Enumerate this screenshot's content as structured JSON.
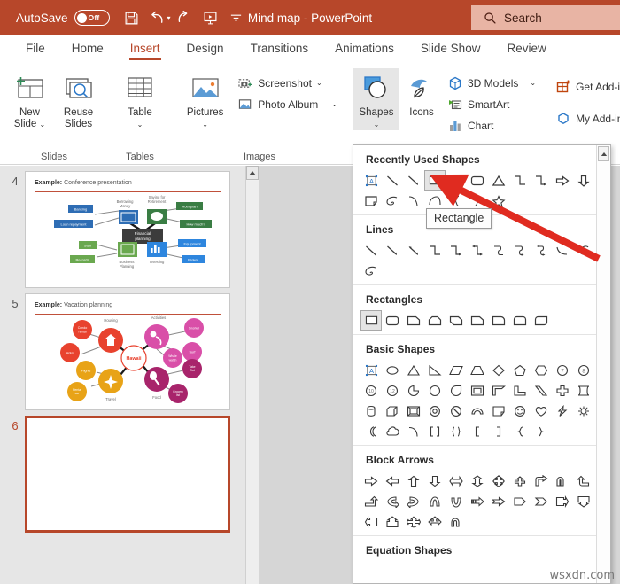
{
  "titlebar": {
    "autosave_label": "AutoSave",
    "autosave_state": "Off",
    "doc_title": "Mind map  -  PowerPoint",
    "search_placeholder": "Search",
    "qat": [
      {
        "name": "save-icon",
        "tip": "Save"
      },
      {
        "name": "undo-icon",
        "tip": "Undo"
      },
      {
        "name": "redo-icon",
        "tip": "Redo"
      },
      {
        "name": "present-icon",
        "tip": "Start From Beginning"
      },
      {
        "name": "customize-qat-icon",
        "tip": "Customize Quick Access Toolbar"
      }
    ],
    "accent_color": "#b7472a"
  },
  "tabs": [
    {
      "label": "File",
      "active": false
    },
    {
      "label": "Home",
      "active": false
    },
    {
      "label": "Insert",
      "active": true
    },
    {
      "label": "Design",
      "active": false
    },
    {
      "label": "Transitions",
      "active": false
    },
    {
      "label": "Animations",
      "active": false
    },
    {
      "label": "Slide Show",
      "active": false
    },
    {
      "label": "Review",
      "active": false
    }
  ],
  "ribbon": {
    "groups": [
      {
        "name": "slides",
        "label": "Slides",
        "buttons": [
          {
            "label": "New\nSlide",
            "label_l1": "New",
            "label_l2": "Slide",
            "dropdown": true
          },
          {
            "label": "Reuse\nSlides",
            "label_l1": "Reuse",
            "label_l2": "Slides",
            "dropdown": false
          }
        ]
      },
      {
        "name": "tables",
        "label": "Tables",
        "buttons": [
          {
            "label_l1": "Table",
            "label_l2": "",
            "dropdown": true
          }
        ]
      },
      {
        "name": "images",
        "label": "Images",
        "buttons": [
          {
            "label_l1": "Pictures",
            "label_l2": "",
            "dropdown": true
          }
        ],
        "small_buttons": [
          {
            "label": "Screenshot",
            "icon": "screenshot-icon",
            "dropdown": true
          },
          {
            "label": "Photo Album",
            "icon": "photo-album-icon",
            "dropdown": true
          }
        ]
      },
      {
        "name": "illustrations",
        "label": "",
        "buttons": [
          {
            "label_l1": "Shapes",
            "label_l2": "",
            "dropdown": true,
            "selected": true
          },
          {
            "label_l1": "Icons",
            "label_l2": "",
            "dropdown": false
          }
        ],
        "small_buttons": [
          {
            "label": "3D Models",
            "icon": "3d-models-icon",
            "dropdown": true
          },
          {
            "label": "SmartArt",
            "icon": "smartart-icon",
            "dropdown": false
          },
          {
            "label": "Chart",
            "icon": "chart-icon",
            "dropdown": false
          }
        ]
      },
      {
        "name": "addins",
        "label": "",
        "small_buttons": [
          {
            "label": "Get Add-ins",
            "icon": "get-addins-icon",
            "dropdown": false
          },
          {
            "label": "My Add-ins",
            "icon": "my-addins-icon",
            "dropdown": false
          }
        ]
      }
    ]
  },
  "slides": [
    {
      "number": "4",
      "title_prefix": "Example:",
      "title_rest": " Conference presentation",
      "selected": false,
      "kind": "mindmap-financial",
      "center_label": "Financial planning",
      "nodes": [
        {
          "label": "Banking",
          "color": "#2e6db4"
        },
        {
          "label": "Loan repayment",
          "color": "#2e6db4"
        },
        {
          "label": "Borrowing Money",
          "color": "#2e6db4"
        },
        {
          "label": "Saving for Retirement",
          "color": "#3a7d44"
        },
        {
          "label": "Roth plan",
          "color": "#3a7d44"
        },
        {
          "label": "How much?",
          "color": "#3a7d44"
        },
        {
          "label": "Staff",
          "color": "#6aa84f"
        },
        {
          "label": "Records",
          "color": "#6aa84f"
        },
        {
          "label": "Business Planning",
          "color": "#6aa84f"
        },
        {
          "label": "Equipment",
          "color": "#2e86de"
        },
        {
          "label": "Broker",
          "color": "#2e86de"
        },
        {
          "label": "Investing",
          "color": "#2e86de"
        }
      ]
    },
    {
      "number": "5",
      "title_prefix": "Example:",
      "title_rest": " Vacation planning",
      "selected": false,
      "kind": "mindmap-vacation",
      "center_label": "Hawaii",
      "nodes": [
        {
          "label": "Condo rental",
          "color": "#e8422e"
        },
        {
          "label": "Hotel",
          "color": "#e8422e"
        },
        {
          "label": "Housing",
          "color": "#e8422e"
        },
        {
          "label": "Activities",
          "color": "#d94fa8"
        },
        {
          "label": "Snorkel",
          "color": "#d94fa8"
        },
        {
          "label": "Surf",
          "color": "#d94fa8"
        },
        {
          "label": "Whale watch",
          "color": "#d94fa8"
        },
        {
          "label": "Flights",
          "color": "#e8a317"
        },
        {
          "label": "Rental car",
          "color": "#e8a317"
        },
        {
          "label": "Travel",
          "color": "#e8a317"
        },
        {
          "label": "Food",
          "color": "#a8246b"
        },
        {
          "label": "Take Out",
          "color": "#a8246b"
        },
        {
          "label": "Grocery list",
          "color": "#a8246b"
        }
      ]
    },
    {
      "number": "6",
      "title_prefix": "",
      "title_rest": "",
      "selected": true,
      "kind": "blank",
      "center_label": "",
      "nodes": []
    }
  ],
  "shapes_panel": {
    "tooltip": "Rectangle",
    "sections": [
      {
        "title": "Recently Used Shapes",
        "shapes": [
          {
            "name": "text-box-shape",
            "glyph": "A",
            "selected": false,
            "boxed": true
          },
          {
            "name": "line-shape",
            "glyph": "line"
          },
          {
            "name": "line-arrow-shape",
            "glyph": "line-arrow"
          },
          {
            "name": "rectangle-shape",
            "glyph": "rect",
            "selected": true
          },
          {
            "name": "oval-shape",
            "glyph": "oval"
          },
          {
            "name": "rounded-rectangle-shape",
            "glyph": "rrect"
          },
          {
            "name": "isosceles-triangle-shape",
            "glyph": "tri"
          },
          {
            "name": "elbow-connector-shape",
            "glyph": "elbow"
          },
          {
            "name": "elbow-arrow-connector-shape",
            "glyph": "elbow-arrow"
          },
          {
            "name": "right-arrow-shape",
            "glyph": "right-arrow"
          },
          {
            "name": "down-arrow-shape",
            "glyph": "down-arrow"
          },
          {
            "name": "folded-corner-shape",
            "glyph": "folded"
          },
          {
            "name": "scribble-shape",
            "glyph": "scribble"
          },
          {
            "name": "curve-shape",
            "glyph": "curve"
          },
          {
            "name": "arc-shape",
            "glyph": "arc"
          },
          {
            "name": "left-brace-shape",
            "glyph": "lbrace"
          },
          {
            "name": "right-brace-shape",
            "glyph": "rbrace"
          },
          {
            "name": "star-5-point-shape",
            "glyph": "star"
          }
        ]
      },
      {
        "title": "Lines",
        "shapes": [
          {
            "name": "line-shape",
            "glyph": "line"
          },
          {
            "name": "line-arrow-shape",
            "glyph": "line-arrow"
          },
          {
            "name": "line-double-arrow-shape",
            "glyph": "line-arrow2"
          },
          {
            "name": "elbow-connector-shape",
            "glyph": "elbow"
          },
          {
            "name": "elbow-arrow-connector-shape",
            "glyph": "elbow-arrow"
          },
          {
            "name": "elbow-double-arrow-connector-shape",
            "glyph": "elbow-arrow2"
          },
          {
            "name": "curved-connector-shape",
            "glyph": "curve-conn"
          },
          {
            "name": "curved-arrow-connector-shape",
            "glyph": "curve-arrow"
          },
          {
            "name": "curved-double-arrow-connector-shape",
            "glyph": "curve-arrow2"
          },
          {
            "name": "curve-shape",
            "glyph": "arc"
          },
          {
            "name": "freeform-shape-shape",
            "glyph": "freeform"
          },
          {
            "name": "scribble-shape",
            "glyph": "scribble"
          }
        ]
      },
      {
        "title": "Rectangles",
        "shapes": [
          {
            "name": "rectangle-shape",
            "glyph": "rect",
            "selected": true
          },
          {
            "name": "rounded-rectangle-shape",
            "glyph": "rrect"
          },
          {
            "name": "snip-single-corner-rectangle-shape",
            "glyph": "snip1"
          },
          {
            "name": "snip-same-side-corner-rectangle-shape",
            "glyph": "snip2"
          },
          {
            "name": "snip-diagonal-corner-rectangle-shape",
            "glyph": "snip3"
          },
          {
            "name": "snip-and-round-single-corner-rectangle-shape",
            "glyph": "snip4"
          },
          {
            "name": "round-single-corner-rectangle-shape",
            "glyph": "round1"
          },
          {
            "name": "round-same-side-corner-rectangle-shape",
            "glyph": "round2"
          },
          {
            "name": "round-diagonal-corner-rectangle-shape",
            "glyph": "round3"
          }
        ]
      },
      {
        "title": "Basic Shapes",
        "shapes": [
          {
            "name": "text-box-shape",
            "glyph": "A",
            "boxed": true
          },
          {
            "name": "oval-shape",
            "glyph": "oval"
          },
          {
            "name": "isosceles-triangle-shape",
            "glyph": "tri"
          },
          {
            "name": "right-triangle-shape",
            "glyph": "rtri"
          },
          {
            "name": "parallelogram-shape",
            "glyph": "para"
          },
          {
            "name": "trapezoid-shape",
            "glyph": "trap"
          },
          {
            "name": "diamond-shape",
            "glyph": "diamond"
          },
          {
            "name": "pentagon-shape",
            "glyph": "pent"
          },
          {
            "name": "hexagon-shape",
            "glyph": "hex"
          },
          {
            "name": "heptagon-shape",
            "glyph": "hept7"
          },
          {
            "name": "octagon-shape",
            "glyph": "oct8"
          },
          {
            "name": "decagon-shape",
            "glyph": "dec10"
          },
          {
            "name": "dodecagon-shape",
            "glyph": "dod12"
          },
          {
            "name": "pie-shape",
            "glyph": "pie"
          },
          {
            "name": "chord-shape",
            "glyph": "chord"
          },
          {
            "name": "teardrop-shape",
            "glyph": "teardrop"
          },
          {
            "name": "frame-shape",
            "glyph": "frame"
          },
          {
            "name": "half-frame-shape",
            "glyph": "halfframe"
          },
          {
            "name": "l-shape-shape",
            "glyph": "lshape"
          },
          {
            "name": "diagonal-stripe-shape",
            "glyph": "stripe"
          },
          {
            "name": "cross-shape",
            "glyph": "cross"
          },
          {
            "name": "plaque-shape",
            "glyph": "plaque"
          },
          {
            "name": "can-shape",
            "glyph": "can"
          },
          {
            "name": "cube-shape",
            "glyph": "cube"
          },
          {
            "name": "bevel-shape",
            "glyph": "bevel"
          },
          {
            "name": "donut-shape",
            "glyph": "donut"
          },
          {
            "name": "no-symbol-shape",
            "glyph": "nosym"
          },
          {
            "name": "block-arc-shape",
            "glyph": "blockarc"
          },
          {
            "name": "folded-corner-shape",
            "glyph": "folded"
          },
          {
            "name": "smiley-face-shape",
            "glyph": "smiley"
          },
          {
            "name": "heart-shape",
            "glyph": "heart"
          },
          {
            "name": "lightning-bolt-shape",
            "glyph": "bolt"
          },
          {
            "name": "sun-shape",
            "glyph": "sun"
          },
          {
            "name": "moon-shape",
            "glyph": "moon"
          },
          {
            "name": "cloud-shape",
            "glyph": "cloud"
          },
          {
            "name": "arc-shape",
            "glyph": "arc2"
          },
          {
            "name": "double-bracket-shape",
            "glyph": "dbracket"
          },
          {
            "name": "double-brace-shape",
            "glyph": "dbrace"
          },
          {
            "name": "left-bracket-shape",
            "glyph": "lbracket"
          },
          {
            "name": "right-bracket-shape",
            "glyph": "rbracket"
          },
          {
            "name": "left-brace-shape",
            "glyph": "lbrace"
          },
          {
            "name": "right-brace-shape",
            "glyph": "rbrace"
          }
        ]
      },
      {
        "title": "Block Arrows",
        "shapes": [
          {
            "name": "right-arrow-shape",
            "glyph": "ba-right"
          },
          {
            "name": "left-arrow-shape",
            "glyph": "ba-left"
          },
          {
            "name": "up-arrow-shape",
            "glyph": "ba-up"
          },
          {
            "name": "down-arrow-shape",
            "glyph": "ba-down"
          },
          {
            "name": "left-right-arrow-shape",
            "glyph": "ba-lr"
          },
          {
            "name": "up-down-arrow-shape",
            "glyph": "ba-ud"
          },
          {
            "name": "four-way-arrow-shape",
            "glyph": "ba-quad"
          },
          {
            "name": "tee-arrow-shape",
            "glyph": "ba-tee"
          },
          {
            "name": "bent-arrow-shape",
            "glyph": "ba-bent"
          },
          {
            "name": "u-turn-arrow-shape",
            "glyph": "ba-uturn"
          },
          {
            "name": "left-up-arrow-shape",
            "glyph": "ba-leftup"
          },
          {
            "name": "bent-up-arrow-shape",
            "glyph": "ba-bentup"
          },
          {
            "name": "curved-right-arrow-shape",
            "glyph": "ba-curvedright"
          },
          {
            "name": "curved-left-arrow-shape",
            "glyph": "ba-curvedleft"
          },
          {
            "name": "curved-up-arrow-shape",
            "glyph": "ba-curvedup"
          },
          {
            "name": "curved-down-arrow-shape",
            "glyph": "ba-curveddown"
          },
          {
            "name": "striped-right-arrow-shape",
            "glyph": "ba-striped"
          },
          {
            "name": "notched-right-arrow-shape",
            "glyph": "ba-notched"
          },
          {
            "name": "pentagon-arrow-shape",
            "glyph": "ba-pentagon"
          },
          {
            "name": "chevron-shape",
            "glyph": "ba-chevron"
          },
          {
            "name": "right-arrow-callout-shape",
            "glyph": "ba-callout-r"
          },
          {
            "name": "down-arrow-callout-shape",
            "glyph": "ba-callout-d"
          },
          {
            "name": "left-arrow-callout-shape",
            "glyph": "ba-callout-l"
          },
          {
            "name": "up-arrow-callout-shape",
            "glyph": "ba-callout-u"
          },
          {
            "name": "quad-arrow-callout-shape",
            "glyph": "ba-quad2"
          },
          {
            "name": "left-right-up-arrow-shape",
            "glyph": "ba-lru"
          },
          {
            "name": "circular-arrow-shape",
            "glyph": "ba-circular"
          }
        ]
      },
      {
        "title": "Equation Shapes",
        "shapes": []
      }
    ]
  },
  "watermark": "wsxdn.com"
}
